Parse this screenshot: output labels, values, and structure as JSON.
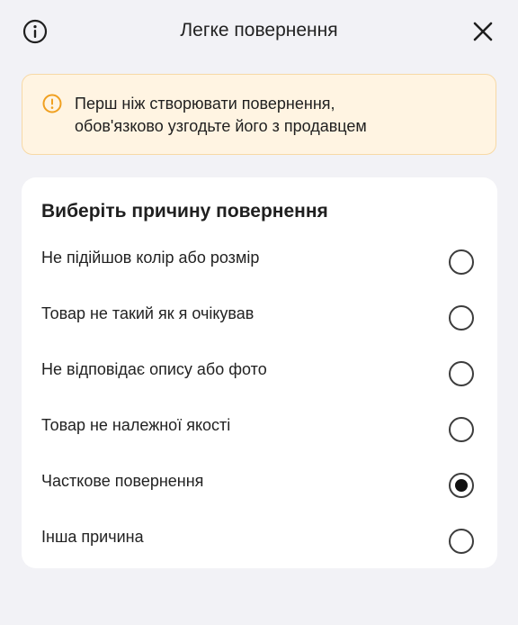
{
  "header": {
    "title": "Легке повернення",
    "info_icon": "info-circle-icon",
    "close_icon": "close-icon"
  },
  "notice": {
    "icon": "warning-info-icon",
    "line1": "Перш ніж створювати повернення,",
    "line2": "обов'язково узгодьте його з продавцем",
    "accent_color": "#f0a020"
  },
  "reasons": {
    "title": "Виберіть причину повернення",
    "options": [
      {
        "label": "Не підійшов колір або розмір",
        "selected": false
      },
      {
        "label": "Товар не такий як я очікував",
        "selected": false
      },
      {
        "label": "Не відповідає опису або фото",
        "selected": false
      },
      {
        "label": "Товар не належної якості",
        "selected": false
      },
      {
        "label": "Часткове повернення",
        "selected": true
      },
      {
        "label": "Інша причина",
        "selected": false
      }
    ]
  }
}
